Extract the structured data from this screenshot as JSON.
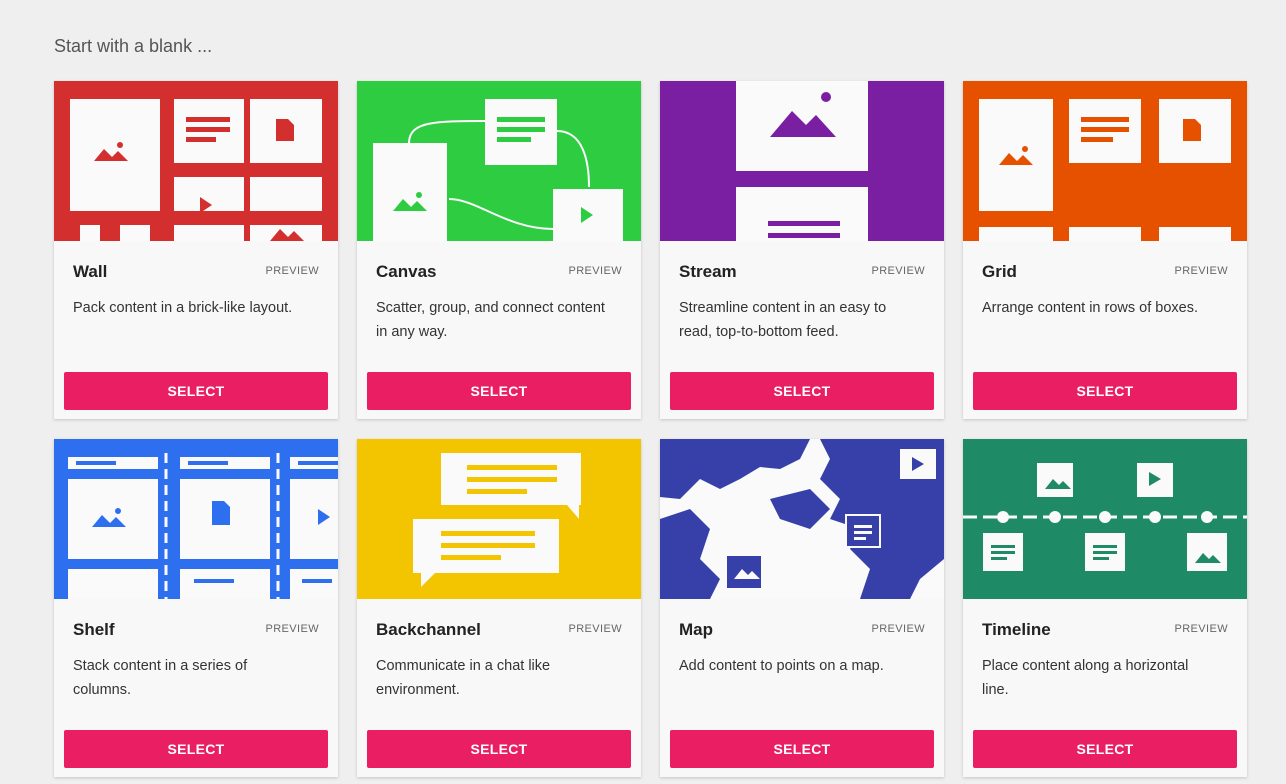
{
  "heading": "Start with a blank ...",
  "preview_label": "PREVIEW",
  "select_label": "SELECT",
  "cards": [
    {
      "title": "Wall",
      "description": "Pack content in a brick-like layout.",
      "color": "#d32f2f",
      "icon": "wall-layout-icon"
    },
    {
      "title": "Canvas",
      "description": "Scatter, group, and connect content in any way.",
      "color": "#2ecc40",
      "icon": "canvas-layout-icon"
    },
    {
      "title": "Stream",
      "description": "Streamline content in an easy to read, top-to-bottom feed.",
      "color": "#7b1fa2",
      "icon": "stream-layout-icon"
    },
    {
      "title": "Grid",
      "description": "Arrange content in rows of boxes.",
      "color": "#e65100",
      "icon": "grid-layout-icon"
    },
    {
      "title": "Shelf",
      "description": "Stack content in a series of columns.",
      "color": "#2e6ff0",
      "icon": "shelf-layout-icon"
    },
    {
      "title": "Backchannel",
      "description": "Communicate in a chat like environment.",
      "color": "#f2c500",
      "icon": "backchannel-layout-icon"
    },
    {
      "title": "Map",
      "description": "Add content to points on a map.",
      "color": "#3640a8",
      "icon": "map-layout-icon"
    },
    {
      "title": "Timeline",
      "description": "Place content along a horizontal line.",
      "color": "#1e8a66",
      "icon": "timeline-layout-icon"
    }
  ],
  "accent_color": "#e91e63"
}
